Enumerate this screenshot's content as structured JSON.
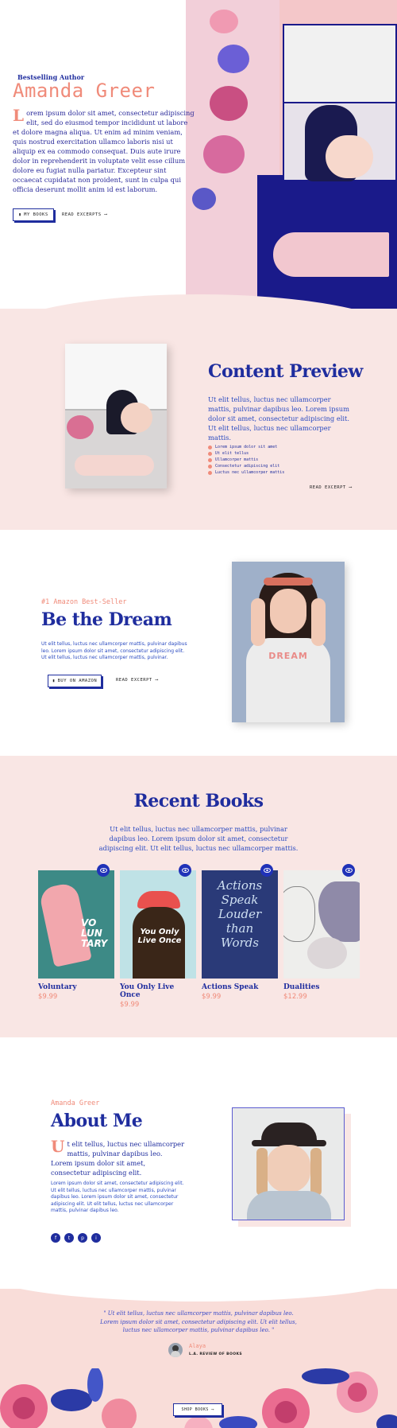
{
  "hero": {
    "eyebrow": "Bestselling Author",
    "title": "Amanda Greer",
    "dropcap": "L",
    "body": "orem ipsum dolor sit amet, consectetur adipiscing elit, sed do eiusmod tempor incididunt ut labore et dolore magna aliqua. Ut enim ad minim veniam, quis nostrud exercitation ullamco laboris nisi ut aliquip ex ea commodo consequat. Duis aute irure dolor in reprehenderit in voluptate velit esse cillum dolore eu fugiat nulla pariatur. Excepteur sint occaecat cupidatat non proident, sunt in culpa qui officia deserunt mollit anim id est laborum.",
    "primary_button": "MY BOOKS",
    "secondary_link": "READ EXCERPTS",
    "button_icon": "book-icon",
    "arrow_icon": "arrow-right-icon"
  },
  "preview": {
    "title": "Content Preview",
    "body": "Ut elit tellus, luctus nec ullamcorper mattis, pulvinar dapibus leo. Lorem ipsum dolor sit amet, consectetur adipiscing elit. Ut elit tellus, luctus nec ullamcorper mattis.",
    "list": [
      "Lorem ipsum dolor sit amet",
      "Ut elit tellus",
      "Ullamcorper mattis",
      "Consectetur adipiscing elit",
      "Luctus nec ullamcorper mattis"
    ],
    "link": "READ EXCERPT"
  },
  "dream": {
    "eyebrow": "#1 Amazon Best-Seller",
    "title": "Be the Dream",
    "body": "Ut elit tellus, luctus nec ullamcorper mattis, pulvinar dapibus leo. Lorem ipsum dolor sit amet, consectetur adipiscing elit. Ut elit tellus, luctus nec ullamcorper mattis, pulvinar.",
    "primary_button": "BUY ON AMAZON",
    "secondary_link": "READ EXCERPT",
    "shirt_text": "DREAM"
  },
  "recent": {
    "title": "Recent Books",
    "body": "Ut elit tellus, luctus nec ullamcorper mattis, pulvinar dapibus leo. Lorem ipsum dolor sit amet, consectetur adipiscing elit. Ut elit tellus, luctus nec ullamcorper mattis.",
    "books": [
      {
        "title": "Voluntary",
        "price": "$9.99",
        "cover_text": "VO LUN TARY"
      },
      {
        "title": "You Only Live Once",
        "price": "$9.99",
        "cover_text": "You Only Live Once"
      },
      {
        "title": "Actions Speak",
        "price": "$9.99",
        "cover_text": "Actions Speak Louder than Words"
      },
      {
        "title": "Dualities",
        "price": "$12.99",
        "cover_text": ""
      }
    ]
  },
  "about": {
    "eyebrow": "Amanda Greer",
    "title": "About Me",
    "dropcap": "U",
    "lead": "t elit tellus, luctus nec ullamcorper mattis, pulvinar dapibus leo. Lorem ipsum dolor sit amet, consectetur adipiscing elit.",
    "body": "Lorem ipsum dolor sit amet, consectetur adipiscing elit. Ut elit tellus, luctus nec ullamcorper mattis, pulvinar dapibus leo. Lorem ipsum dolor sit amet, consectetur adipiscing elit. Ut elit tellus, luctus nec ullamcorper mattis, pulvinar dapibus leo.",
    "social": [
      "f",
      "t",
      "p",
      "i"
    ]
  },
  "testimonial": {
    "quote": "\" Ut elit tellus, luctus nec ullamcorper mattis, pulvinar dapibus leo. Lorem ipsum dolor sit amet, consectetur adipiscing elit. Ut elit tellus, luctus nec ullamcorper mattis, pulvinar dapibus leo. \"",
    "author": "Alaya",
    "role": "L.A. REVIEW OF BOOKS",
    "button": "SHOP BOOKS"
  },
  "colors": {
    "primary": "#1f2d9e",
    "accent": "#f08b7a",
    "pink_bg": "#f9e6e4"
  }
}
